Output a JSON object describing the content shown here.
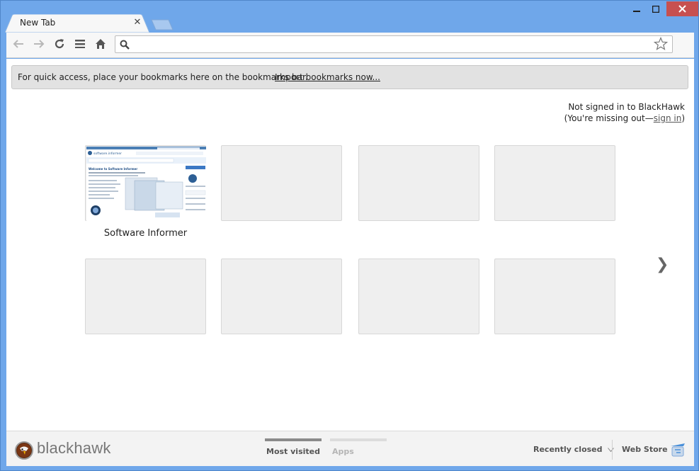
{
  "tab": {
    "title": "New Tab"
  },
  "window_controls": {
    "minimize": "—",
    "maximize": "☐",
    "close": "✕"
  },
  "toolbar": {
    "omnibox_value": "",
    "omnibox_placeholder": ""
  },
  "bookmark_bar": {
    "message": "For quick access, place your bookmarks here on the bookmarks bar.",
    "import_link": "Import bookmarks now..."
  },
  "signin": {
    "line1": "Not signed in to BlackHawk",
    "line2_prefix": "(You're missing out—",
    "link": "sign in",
    "line2_suffix": ")"
  },
  "tiles": [
    {
      "label": "Software Informer",
      "has_thumbnail": true
    },
    {
      "label": "",
      "has_thumbnail": false
    },
    {
      "label": "",
      "has_thumbnail": false
    },
    {
      "label": "",
      "has_thumbnail": false
    },
    {
      "label": "",
      "has_thumbnail": false
    },
    {
      "label": "",
      "has_thumbnail": false
    },
    {
      "label": "",
      "has_thumbnail": false
    },
    {
      "label": "",
      "has_thumbnail": false
    }
  ],
  "thumbnail": {
    "site_name": "software.informer",
    "heading": "Welcome to Software Informer"
  },
  "footer": {
    "brand": "blackhawk",
    "tabs": [
      {
        "label": "Most visited",
        "active": true
      },
      {
        "label": "Apps",
        "active": false
      }
    ],
    "recently_closed": "Recently closed",
    "web_store": "Web Store"
  },
  "colors": {
    "frame": "#6fa7ea",
    "active_tab_bar": "#8a8a8a",
    "inactive_tab_bar": "#dcdcdc"
  }
}
